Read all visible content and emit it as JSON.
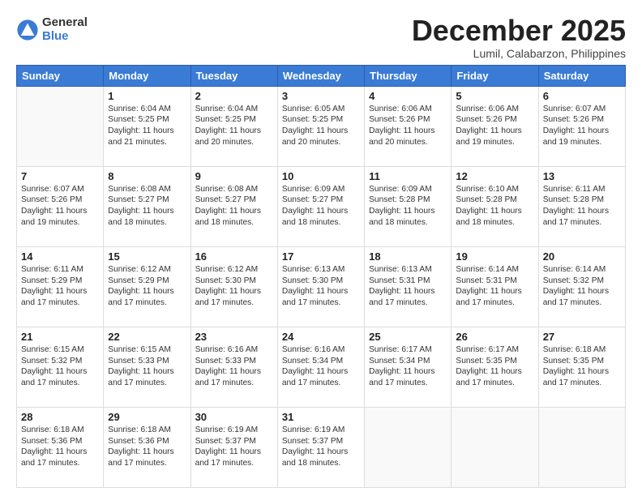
{
  "logo": {
    "general": "General",
    "blue": "Blue"
  },
  "title": "December 2025",
  "location": "Lumil, Calabarzon, Philippines",
  "header_days": [
    "Sunday",
    "Monday",
    "Tuesday",
    "Wednesday",
    "Thursday",
    "Friday",
    "Saturday"
  ],
  "weeks": [
    [
      {
        "day": "",
        "info": ""
      },
      {
        "day": "1",
        "info": "Sunrise: 6:04 AM\nSunset: 5:25 PM\nDaylight: 11 hours\nand 21 minutes."
      },
      {
        "day": "2",
        "info": "Sunrise: 6:04 AM\nSunset: 5:25 PM\nDaylight: 11 hours\nand 20 minutes."
      },
      {
        "day": "3",
        "info": "Sunrise: 6:05 AM\nSunset: 5:25 PM\nDaylight: 11 hours\nand 20 minutes."
      },
      {
        "day": "4",
        "info": "Sunrise: 6:06 AM\nSunset: 5:26 PM\nDaylight: 11 hours\nand 20 minutes."
      },
      {
        "day": "5",
        "info": "Sunrise: 6:06 AM\nSunset: 5:26 PM\nDaylight: 11 hours\nand 19 minutes."
      },
      {
        "day": "6",
        "info": "Sunrise: 6:07 AM\nSunset: 5:26 PM\nDaylight: 11 hours\nand 19 minutes."
      }
    ],
    [
      {
        "day": "7",
        "info": "Sunrise: 6:07 AM\nSunset: 5:26 PM\nDaylight: 11 hours\nand 19 minutes."
      },
      {
        "day": "8",
        "info": "Sunrise: 6:08 AM\nSunset: 5:27 PM\nDaylight: 11 hours\nand 18 minutes."
      },
      {
        "day": "9",
        "info": "Sunrise: 6:08 AM\nSunset: 5:27 PM\nDaylight: 11 hours\nand 18 minutes."
      },
      {
        "day": "10",
        "info": "Sunrise: 6:09 AM\nSunset: 5:27 PM\nDaylight: 11 hours\nand 18 minutes."
      },
      {
        "day": "11",
        "info": "Sunrise: 6:09 AM\nSunset: 5:28 PM\nDaylight: 11 hours\nand 18 minutes."
      },
      {
        "day": "12",
        "info": "Sunrise: 6:10 AM\nSunset: 5:28 PM\nDaylight: 11 hours\nand 18 minutes."
      },
      {
        "day": "13",
        "info": "Sunrise: 6:11 AM\nSunset: 5:28 PM\nDaylight: 11 hours\nand 17 minutes."
      }
    ],
    [
      {
        "day": "14",
        "info": "Sunrise: 6:11 AM\nSunset: 5:29 PM\nDaylight: 11 hours\nand 17 minutes."
      },
      {
        "day": "15",
        "info": "Sunrise: 6:12 AM\nSunset: 5:29 PM\nDaylight: 11 hours\nand 17 minutes."
      },
      {
        "day": "16",
        "info": "Sunrise: 6:12 AM\nSunset: 5:30 PM\nDaylight: 11 hours\nand 17 minutes."
      },
      {
        "day": "17",
        "info": "Sunrise: 6:13 AM\nSunset: 5:30 PM\nDaylight: 11 hours\nand 17 minutes."
      },
      {
        "day": "18",
        "info": "Sunrise: 6:13 AM\nSunset: 5:31 PM\nDaylight: 11 hours\nand 17 minutes."
      },
      {
        "day": "19",
        "info": "Sunrise: 6:14 AM\nSunset: 5:31 PM\nDaylight: 11 hours\nand 17 minutes."
      },
      {
        "day": "20",
        "info": "Sunrise: 6:14 AM\nSunset: 5:32 PM\nDaylight: 11 hours\nand 17 minutes."
      }
    ],
    [
      {
        "day": "21",
        "info": "Sunrise: 6:15 AM\nSunset: 5:32 PM\nDaylight: 11 hours\nand 17 minutes."
      },
      {
        "day": "22",
        "info": "Sunrise: 6:15 AM\nSunset: 5:33 PM\nDaylight: 11 hours\nand 17 minutes."
      },
      {
        "day": "23",
        "info": "Sunrise: 6:16 AM\nSunset: 5:33 PM\nDaylight: 11 hours\nand 17 minutes."
      },
      {
        "day": "24",
        "info": "Sunrise: 6:16 AM\nSunset: 5:34 PM\nDaylight: 11 hours\nand 17 minutes."
      },
      {
        "day": "25",
        "info": "Sunrise: 6:17 AM\nSunset: 5:34 PM\nDaylight: 11 hours\nand 17 minutes."
      },
      {
        "day": "26",
        "info": "Sunrise: 6:17 AM\nSunset: 5:35 PM\nDaylight: 11 hours\nand 17 minutes."
      },
      {
        "day": "27",
        "info": "Sunrise: 6:18 AM\nSunset: 5:35 PM\nDaylight: 11 hours\nand 17 minutes."
      }
    ],
    [
      {
        "day": "28",
        "info": "Sunrise: 6:18 AM\nSunset: 5:36 PM\nDaylight: 11 hours\nand 17 minutes."
      },
      {
        "day": "29",
        "info": "Sunrise: 6:18 AM\nSunset: 5:36 PM\nDaylight: 11 hours\nand 17 minutes."
      },
      {
        "day": "30",
        "info": "Sunrise: 6:19 AM\nSunset: 5:37 PM\nDaylight: 11 hours\nand 17 minutes."
      },
      {
        "day": "31",
        "info": "Sunrise: 6:19 AM\nSunset: 5:37 PM\nDaylight: 11 hours\nand 18 minutes."
      },
      {
        "day": "",
        "info": ""
      },
      {
        "day": "",
        "info": ""
      },
      {
        "day": "",
        "info": ""
      }
    ]
  ]
}
